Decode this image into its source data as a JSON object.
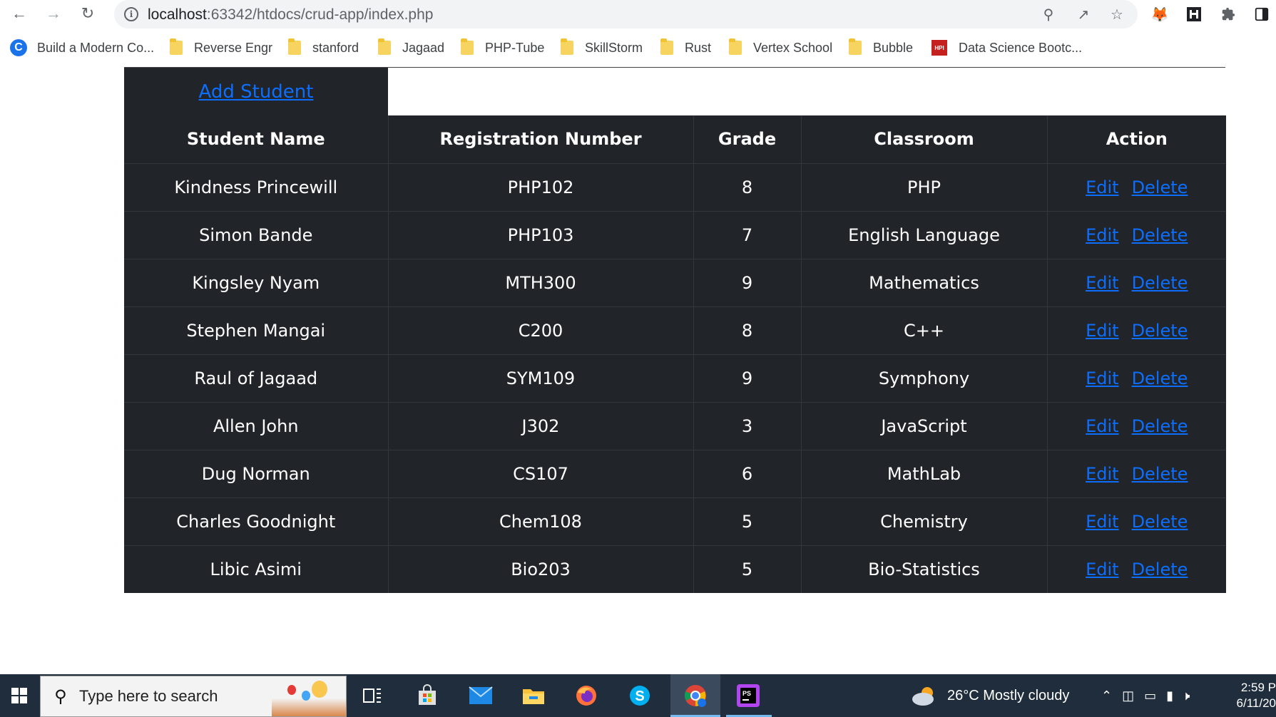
{
  "browser": {
    "url_host": "localhost",
    "url_rest": ":63342/htdocs/crud-app/index.php",
    "bookmarks": [
      "Build a Modern Co...",
      "Reverse Engr",
      "stanford",
      "Jagaad",
      "PHP-Tube",
      "SkillStorm",
      "Rust",
      "Vertex School",
      "Bubble",
      "Data Science Bootc..."
    ]
  },
  "page": {
    "add_student_label": "Add Student",
    "table": {
      "headers": [
        "Student Name",
        "Registration Number",
        "Grade",
        "Classroom",
        "Action"
      ],
      "edit_label": "Edit",
      "delete_label": "Delete",
      "rows": [
        {
          "name": "Kindness Princewill",
          "reg": "PHP102",
          "grade": "8",
          "classroom": "PHP"
        },
        {
          "name": "Simon Bande",
          "reg": "PHP103",
          "grade": "7",
          "classroom": "English Language"
        },
        {
          "name": "Kingsley Nyam",
          "reg": "MTH300",
          "grade": "9",
          "classroom": "Mathematics"
        },
        {
          "name": "Stephen Mangai",
          "reg": "C200",
          "grade": "8",
          "classroom": "C++"
        },
        {
          "name": "Raul of Jagaad",
          "reg": "SYM109",
          "grade": "9",
          "classroom": "Symphony"
        },
        {
          "name": "Allen John",
          "reg": "J302",
          "grade": "3",
          "classroom": "JavaScript"
        },
        {
          "name": "Dug Norman",
          "reg": "CS107",
          "grade": "6",
          "classroom": "MathLab"
        },
        {
          "name": "Charles Goodnight",
          "reg": "Chem108",
          "grade": "5",
          "classroom": "Chemistry"
        },
        {
          "name": "Libic Asimi",
          "reg": "Bio203",
          "grade": "5",
          "classroom": "Bio-Statistics"
        }
      ]
    }
  },
  "taskbar": {
    "search_placeholder": "Type here to search",
    "weather": "26°C  Mostly cloudy",
    "time": "2:59 P",
    "date": "6/11/20"
  },
  "colors": {
    "table_bg": "#212529",
    "link": "#0d6efd",
    "taskbar_bg": "#1f2d3d"
  }
}
